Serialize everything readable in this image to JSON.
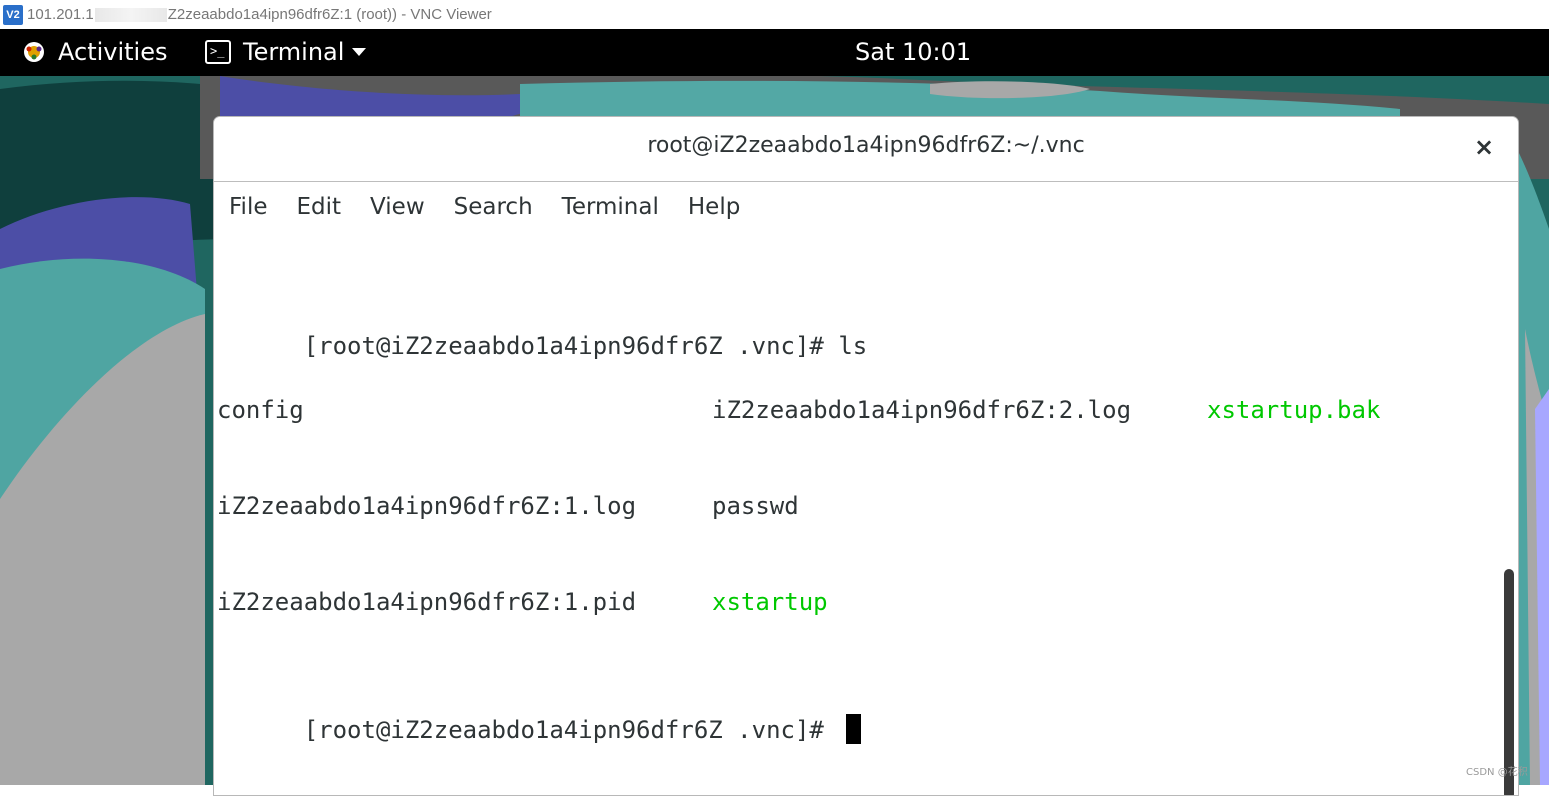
{
  "vnc_window": {
    "icon_label": "V2",
    "title_prefix": "101.201.1",
    "title_suffix": "Z2zeaabdo1a4ipn96dfr6Z:1 (root)) - VNC Viewer"
  },
  "gnome_topbar": {
    "activities_label": "Activities",
    "activities_icon": "gnome-foot-icon",
    "app_menu_label": "Terminal",
    "app_menu_icon": "terminal-icon",
    "clock": "Sat 10:01"
  },
  "terminal_window": {
    "title": "root@iZ2zeaabdo1a4ipn96dfr6Z:~/.vnc",
    "close_glyph": "×",
    "menu": [
      "File",
      "Edit",
      "View",
      "Search",
      "Terminal",
      "Help"
    ],
    "lines": {
      "cmd": "[root@iZ2zeaabdo1a4ipn96dfr6Z .vnc]# ls",
      "row1": [
        "config",
        "iZ2zeaabdo1a4ipn96dfr6Z:2.log",
        "xstartup.bak"
      ],
      "row2": [
        "iZ2zeaabdo1a4ipn96dfr6Z:1.log",
        "passwd"
      ],
      "row3": [
        "iZ2zeaabdo1a4ipn96dfr6Z:1.pid",
        "xstartup"
      ],
      "prompt": "[root@iZ2zeaabdo1a4ipn96dfr6Z .vnc]# "
    },
    "colors": {
      "executable": "#00c800",
      "text": "#2e3436"
    }
  },
  "watermark": "CSDN @花积"
}
